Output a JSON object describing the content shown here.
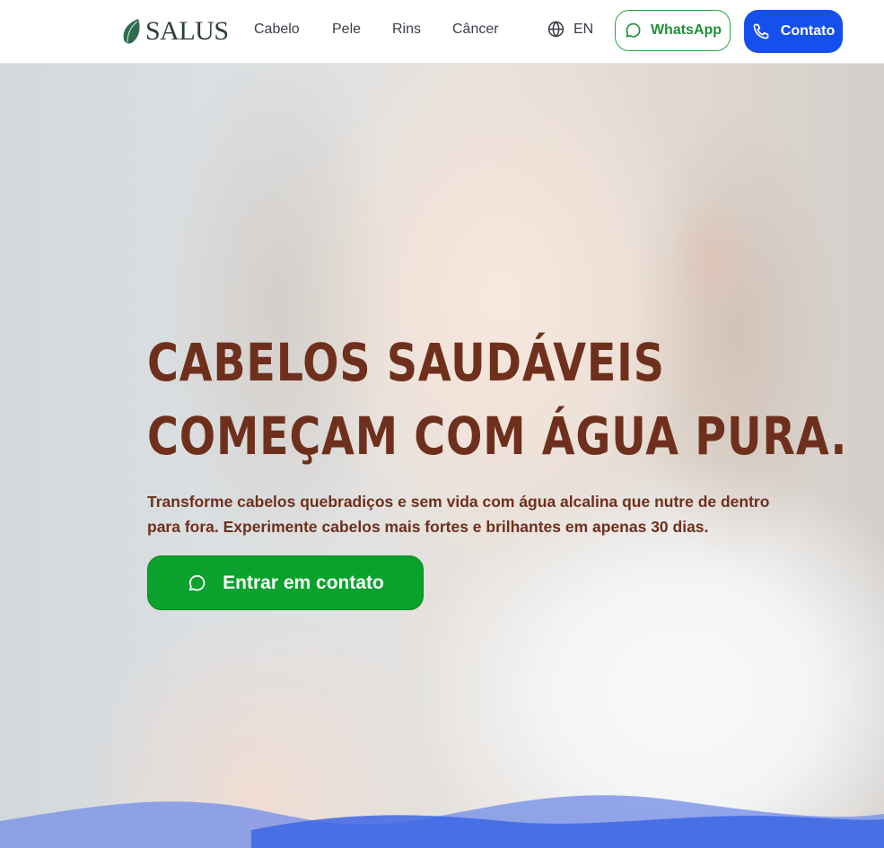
{
  "header": {
    "brand": "SALUS",
    "nav": [
      {
        "label": "Cabelo"
      },
      {
        "label": "Pele"
      },
      {
        "label": "Rins"
      },
      {
        "label": "Câncer"
      }
    ],
    "language_label": "EN",
    "whatsapp_label": "WhatsApp",
    "contact_label": "Contato"
  },
  "hero": {
    "headline_line1": "CABELOS SAUDÁVEIS",
    "headline_line2": "COMEÇAM COM ÁGUA PURA.",
    "subtitle": "Transforme cabelos quebradiços e sem vida com água alcalina que nutre de dentro para fora. Experimente cabelos mais fortes e brilhantes em apenas 30 dias.",
    "cta_label": "Entrar em contato"
  },
  "colors": {
    "primary_blue": "#1550ec",
    "whatsapp_green": "#0aa22d",
    "headline_brown": "#6e301c"
  },
  "icons": {
    "globe": "globe-icon",
    "whatsapp": "whatsapp-icon",
    "phone": "phone-icon"
  }
}
